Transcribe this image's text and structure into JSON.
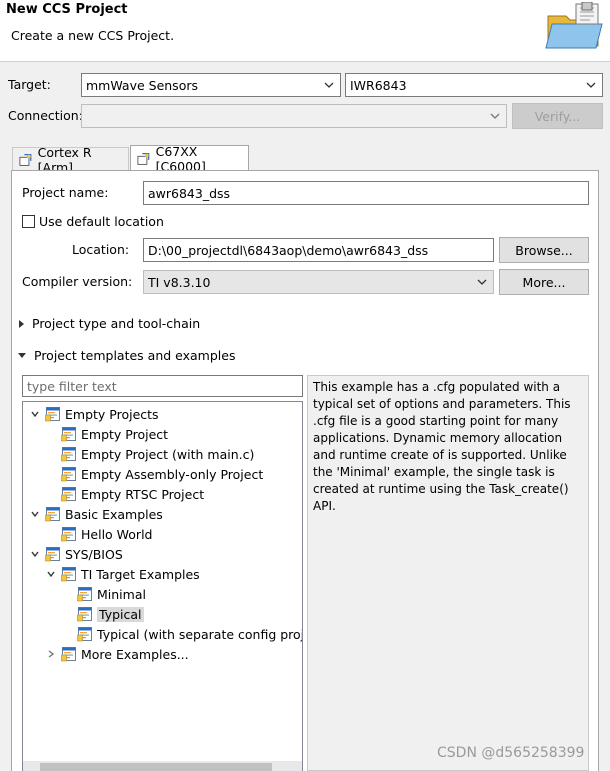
{
  "header": {
    "title": "New CCS Project",
    "subtitle": "Create a new CCS Project."
  },
  "target": {
    "label": "Target:",
    "family": "mmWave Sensors",
    "device": "IWR6843"
  },
  "connection": {
    "label": "Connection:",
    "value": "",
    "verify_label": "Verify..."
  },
  "tabs": [
    {
      "label": "Cortex R [Arm]",
      "active": false
    },
    {
      "label": "C67XX [C6000]",
      "active": true
    }
  ],
  "project": {
    "name_label": "Project name:",
    "name": "awr6843_dss",
    "use_default_label": "Use default location",
    "use_default_checked": false,
    "location_label": "Location:",
    "location": "D:\\00_projectdl\\6843aop\\demo\\awr6843_dss",
    "browse_label": "Browse...",
    "compiler_label": "Compiler version:",
    "compiler": "TI v8.3.10",
    "more_label": "More..."
  },
  "sections": {
    "toolchain": "Project type and tool-chain",
    "templates": "Project templates and examples"
  },
  "filter": {
    "placeholder": "type filter text"
  },
  "tree": [
    {
      "label": "Empty Projects",
      "level": 0,
      "expander": "down"
    },
    {
      "label": "Empty Project",
      "level": 1,
      "expander": "none"
    },
    {
      "label": "Empty Project (with main.c)",
      "level": 1,
      "expander": "none"
    },
    {
      "label": "Empty Assembly-only Project",
      "level": 1,
      "expander": "none"
    },
    {
      "label": "Empty RTSC Project",
      "level": 1,
      "expander": "none"
    },
    {
      "label": "Basic Examples",
      "level": 0,
      "expander": "down"
    },
    {
      "label": "Hello World",
      "level": 1,
      "expander": "none"
    },
    {
      "label": "SYS/BIOS",
      "level": 0,
      "expander": "down"
    },
    {
      "label": "TI Target Examples",
      "level": 1,
      "expander": "down"
    },
    {
      "label": "Minimal",
      "level": 2,
      "expander": "none"
    },
    {
      "label": "Typical",
      "level": 2,
      "expander": "none",
      "selected": true
    },
    {
      "label": "Typical (with separate config project)",
      "level": 2,
      "expander": "none"
    },
    {
      "label": "More Examples...",
      "level": 1,
      "expander": "right"
    }
  ],
  "description": [
    "This example has a .cfg populated with a",
    "typical set of options and parameters.  This",
    ".cfg file is a good starting point for many",
    "applications.  Dynamic memory allocation",
    "and runtime create of is supported.  Unlike",
    "the 'Minimal' example, the single task is",
    "created at runtime using the Task_create()",
    "API."
  ],
  "watermark": "CSDN @d565258399",
  "colors": {
    "accent_blue": "#2b6cc4",
    "folder_yellow": "#f4c542",
    "selection": "#d9d9d9"
  }
}
